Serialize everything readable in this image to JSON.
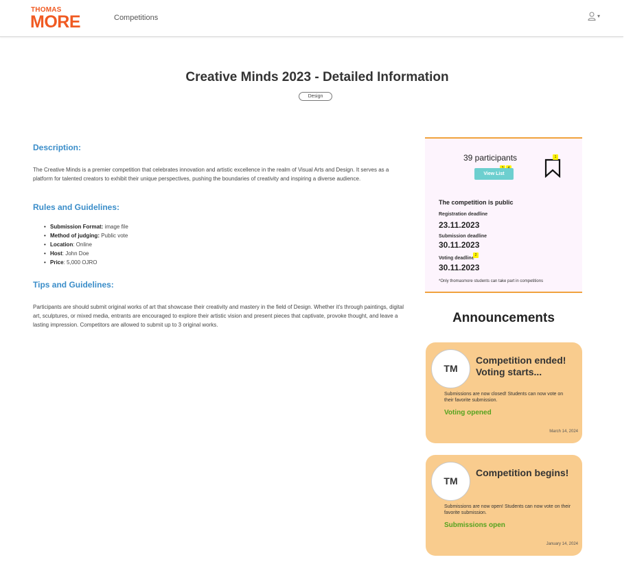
{
  "header": {
    "logo_top": "THOMAS",
    "logo_main": "MORE",
    "nav_competitions": "Competitions",
    "user_icon": "user-icon",
    "caret": "▾"
  },
  "title": "Creative Minds 2023 - Detailed Information",
  "category_tag": "Design",
  "description": {
    "heading": "Description:",
    "text": "The Creative Minds is a premier competition that celebrates innovation and artistic excellence in the realm of Visual Arts and Design. It serves as a platform for talented creators to exhibit their unique perspectives, pushing the boundaries of creativity and inspiring a diverse audience."
  },
  "rules": {
    "heading": "Rules and Guidelines:",
    "items": [
      {
        "label": "Submission Format:",
        "value": " image file"
      },
      {
        "label": "Method of judging:",
        "value": " Public vote"
      },
      {
        "label": "Location",
        "value": ": Online"
      },
      {
        "label": "Host",
        "value": ": John Doe"
      },
      {
        "label": "Price",
        "value": ": 5,000 OJRO"
      }
    ]
  },
  "tips": {
    "heading": "Tips and Guidelines:",
    "text": "Participants are should submit original works of art that showcase their creativity and mastery in the field of Design. Whether it's through paintings, digital art, sculptures, or mixed media, entrants are encouraged to explore their artistic vision and present pieces that captivate, provoke thought, and leave a lasting impression. Competitors are allowed to submit up to 3 original works."
  },
  "info": {
    "participants": "39 participants",
    "view_list": "View List",
    "badges": {
      "bookmark": "1",
      "voting": "2",
      "view_a": "3",
      "view_b": "4"
    },
    "public_text": "The competition is public",
    "registration_label": "Registration deadline",
    "registration_date": "23.11.2023",
    "submission_label": "Submission deadline",
    "submission_date": "30.11.2023",
    "voting_label": "Voting deadline",
    "voting_date": "30.11.2023",
    "note": "*Only thomasmore students can take part in competitions"
  },
  "announcements": {
    "title": "Announcements",
    "items": [
      {
        "avatar": "TM",
        "heading": "Competition ended! Voting starts...",
        "text": "Submissions are now closed! Students can now vote on their favorite submission.",
        "status": "Voting opened",
        "date": "March 14, 2024"
      },
      {
        "avatar": "TM",
        "heading": "Competition begins!",
        "text": "Submissions are now open! Students can now vote on their favorite submission.",
        "status": "Submissions open",
        "date": "January 14, 2024"
      }
    ]
  },
  "colors": {
    "brand": "#f05a22",
    "heading_blue": "#3a8dc9",
    "card_border": "#f0a23c",
    "card_bg": "#fdf4fd",
    "button_teal": "#6dcfcf",
    "announcement_bg": "#f9cc8e",
    "status_green": "#55a31f"
  }
}
